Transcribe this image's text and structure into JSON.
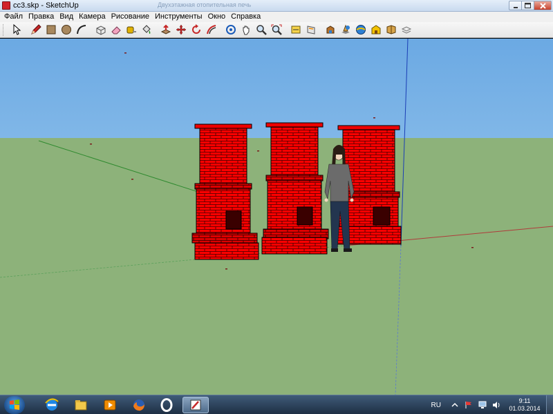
{
  "window": {
    "title": "cc3.skp - SketchUp",
    "ghost_title": "Двухэтажная отопительная печь",
    "controls": {
      "minimize": "minimize",
      "maximize": "maximize",
      "close": "close"
    }
  },
  "menu": {
    "items": [
      "Файл",
      "Правка",
      "Вид",
      "Камера",
      "Рисование",
      "Инструменты",
      "Окно",
      "Справка"
    ]
  },
  "toolbar": {
    "tools": [
      "select-icon",
      "pencil-icon",
      "rectangle-icon",
      "circle-icon",
      "arc-icon",
      "make-component-icon",
      "eraser-icon",
      "tape-measure-icon",
      "paint-bucket-icon",
      "push-pull-icon",
      "move-icon",
      "rotate-icon",
      "offset-icon",
      "orbit-icon",
      "pan-icon",
      "zoom-icon",
      "zoom-extents-icon",
      "dimension-icon",
      "section-plane-icon",
      "get-models-icon",
      "share-model-icon",
      "component-icon",
      "warehouse-icon",
      "extension-icon",
      "layers-icon"
    ]
  },
  "scene": {
    "sky_color_top": "#6ba9e3",
    "sky_color_bottom": "#b8dbf4",
    "ground_color": "#8db27a",
    "brick_color": "#ff0000",
    "axis_blue": "#1a3db5",
    "axis_red": "#b03a3a",
    "axis_green": "#2f8a2f"
  },
  "taskbar": {
    "apps": [
      "internet-explorer-icon",
      "file-explorer-icon",
      "media-player-icon",
      "firefox-icon",
      "opera-icon",
      "sketchup-icon"
    ],
    "language": "RU",
    "time": "9:11",
    "date": "01.03.2014"
  }
}
